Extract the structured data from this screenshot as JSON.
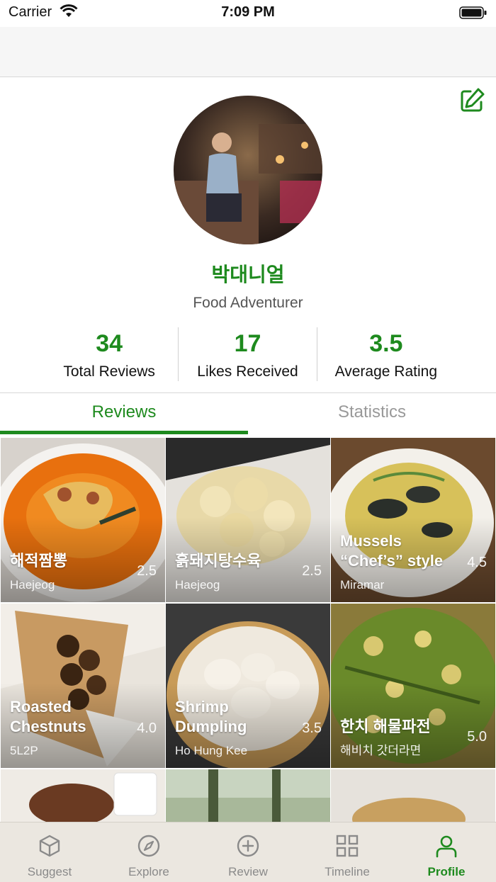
{
  "status_bar": {
    "carrier": "Carrier",
    "time": "7:09 PM"
  },
  "profile": {
    "name": "박대니얼",
    "title": "Food Adventurer",
    "stats": [
      {
        "value": "34",
        "label": "Total Reviews"
      },
      {
        "value": "17",
        "label": "Likes Received"
      },
      {
        "value": "3.5",
        "label": "Average Rating"
      }
    ]
  },
  "tabs": [
    {
      "label": "Reviews",
      "active": true
    },
    {
      "label": "Statistics",
      "active": false
    }
  ],
  "reviews": [
    {
      "dish": "해적짬뽕",
      "restaurant": "Haejeog",
      "rating": "2.5"
    },
    {
      "dish": "흙돼지탕수육",
      "restaurant": "Haejeog",
      "rating": "2.5"
    },
    {
      "dish": "Mussels “Chef’s” style",
      "restaurant": "Miramar",
      "rating": "4.5"
    },
    {
      "dish": "Roasted Chestnuts",
      "restaurant": "5L2P",
      "rating": "4.0"
    },
    {
      "dish": "Shrimp Dumpling",
      "restaurant": "Ho Hung Kee",
      "rating": "3.5"
    },
    {
      "dish": "한치 해물파전",
      "restaurant": "해비치 갓더라면",
      "rating": "5.0"
    }
  ],
  "tabbar": [
    {
      "label": "Suggest",
      "icon": "cube-icon"
    },
    {
      "label": "Explore",
      "icon": "compass-icon"
    },
    {
      "label": "Review",
      "icon": "plus-circle-icon"
    },
    {
      "label": "Timeline",
      "icon": "grid-icon"
    },
    {
      "label": "Profile",
      "icon": "person-icon",
      "active": true
    }
  ],
  "colors": {
    "accent": "#1e8a1e"
  }
}
